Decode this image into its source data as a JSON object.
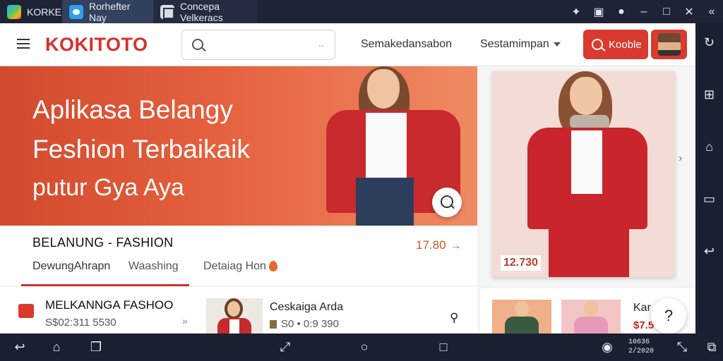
{
  "tabs": [
    {
      "label": "KORKE"
    },
    {
      "label": "Rorhefter Nay"
    },
    {
      "label": "Concepa Velkeracs"
    }
  ],
  "app": {
    "logo": "KOKITOTO",
    "search_placeholder": "",
    "search_mic_glyph": "‥",
    "nav_link_1": "Semakedansabon",
    "nav_link_2": "Sestamimpan",
    "search_button": "Kooble"
  },
  "hero": {
    "line1": "Aplikasa Belangy",
    "line2": "Feshion Terbaikaik",
    "line3": "putur Gya Aya"
  },
  "info": {
    "title": "BELANUNG - FASHION",
    "price": "17.80",
    "tab1": "DewungAhrapn",
    "tab2": "Waashing",
    "tab3": "Detaiag Hon"
  },
  "row": {
    "title": "MELKANNGA FASHOO",
    "sub": "S$02:311 5530",
    "item_title": "Ceskaiga Arda",
    "item_sub": "S0 • 0:9 390"
  },
  "side": {
    "card_price": "12.730",
    "partial_title": "Kar",
    "partial_price": "$7.5"
  },
  "clock": {
    "line1": "10636",
    "line2": "2/2020"
  },
  "colors": {
    "brand_red": "#d83a30",
    "hero_orange": "#e4603e"
  }
}
